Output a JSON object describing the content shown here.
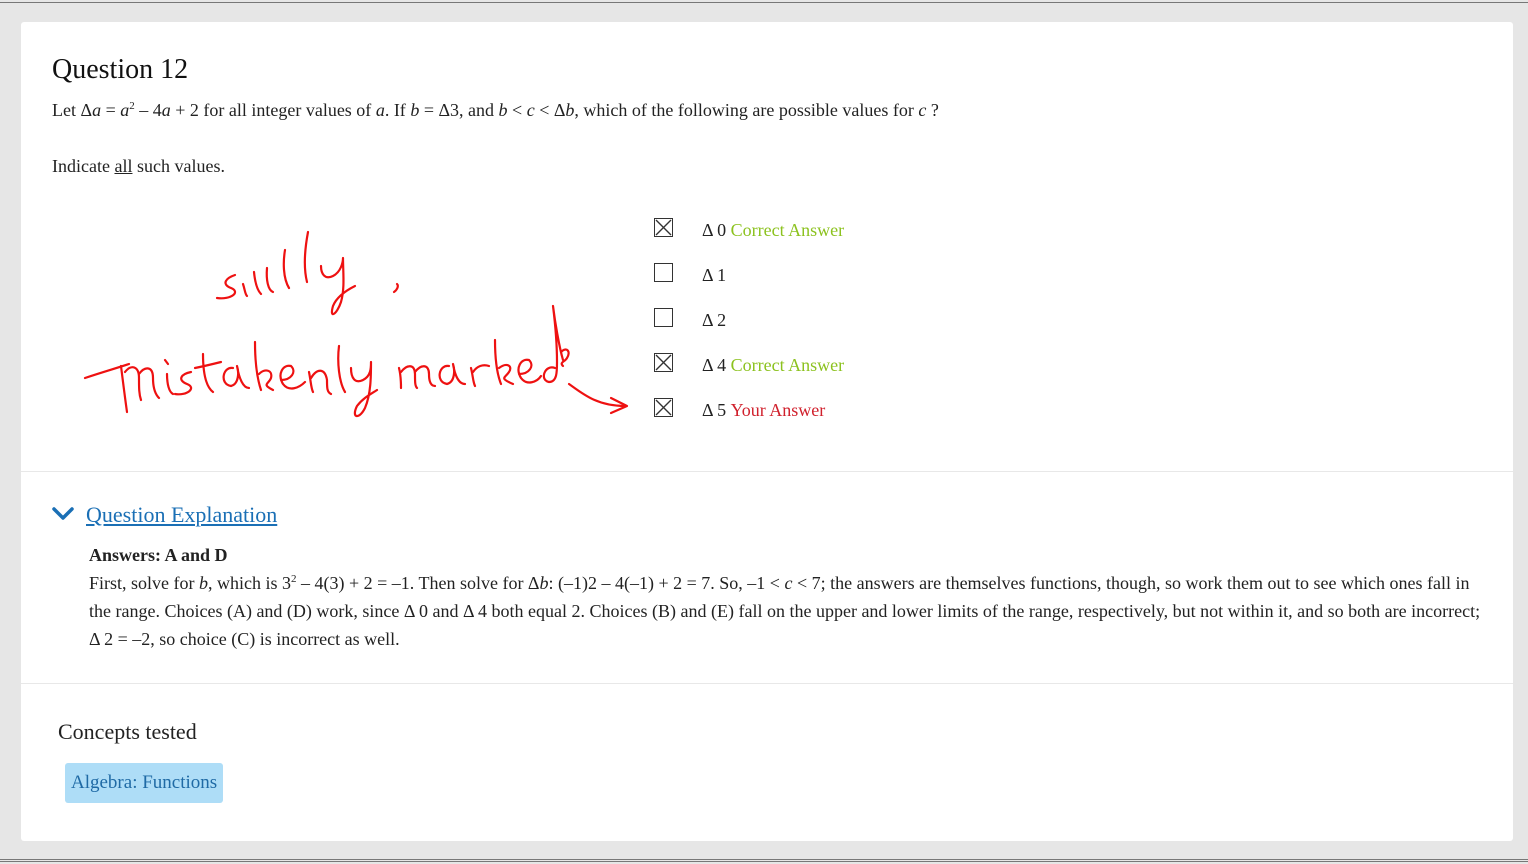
{
  "question": {
    "title": "Question 12",
    "stem_start": "Let Δ",
    "stem_a1": "a",
    "stem_eq": " = ",
    "stem_a2": "a",
    "stem_exp": "2",
    "stem_mid": " – 4",
    "stem_a3": "a",
    "stem_tail1": " + 2 for all integer values of ",
    "stem_a4": "a",
    "stem_tail2": ". If ",
    "stem_b1": "b",
    "stem_tail3": " = Δ3, and ",
    "stem_b2": "b",
    "stem_lt1": " < ",
    "stem_c1": "c",
    "stem_lt2": " < Δ",
    "stem_b3": "b",
    "stem_tail4": ", which of the following are possible values for ",
    "stem_c2": "c",
    "stem_q": " ?",
    "instruction_pre": "Indicate ",
    "instruction_all": "all",
    "instruction_post": " such values."
  },
  "choices": [
    {
      "label": "Δ 0",
      "checked": true,
      "tag": "Correct Answer",
      "tag_type": "correct"
    },
    {
      "label": "Δ 1",
      "checked": false,
      "tag": "",
      "tag_type": ""
    },
    {
      "label": "Δ 2",
      "checked": false,
      "tag": "",
      "tag_type": ""
    },
    {
      "label": "Δ 4",
      "checked": true,
      "tag": "Correct Answer",
      "tag_type": "correct"
    },
    {
      "label": "Δ 5",
      "checked": true,
      "tag": "Your Answer",
      "tag_type": "yours"
    }
  ],
  "annotation": {
    "text": "silly, mistakenly marked",
    "color": "#ee1111"
  },
  "explanation": {
    "toggle_label": "Question Explanation",
    "answers": "Answers: A and D",
    "p1_a": "First, solve for ",
    "p1_b": "b",
    "p1_c": ", which is 3",
    "p1_exp": "2",
    "p1_d": " – 4(3) + 2 = –1. Then solve for Δ",
    "p1_e": "b",
    "p1_f": ": (–1)2 – 4(–1) + 2 = 7. So, –1 < ",
    "p1_g": "c",
    "p1_h": " < 7; the answers are themselves functions, though, so work them out to see which ones fall in the range. Choices (A) and (D) work, since Δ 0 and Δ 4 both equal 2. Choices (B) and (E) fall on the upper and lower limits of the range, respectively, but not within it, and so both are incorrect; Δ 2 = –2, so choice (C) is incorrect as well."
  },
  "concepts": {
    "title": "Concepts tested",
    "items": [
      "Algebra: Functions"
    ]
  },
  "colors": {
    "correct": "#8cc21f",
    "yours": "#d0202c",
    "link": "#1a6fb5",
    "chip_bg": "#aeddf7"
  }
}
